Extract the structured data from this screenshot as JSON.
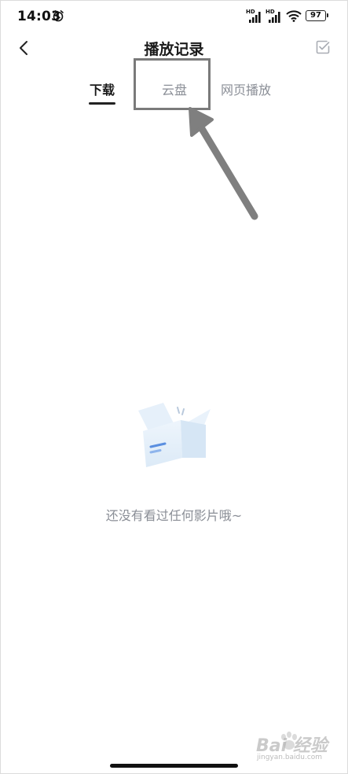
{
  "status_bar": {
    "time": "14:03",
    "signal1_label": "HD",
    "signal2_label": "HD",
    "battery": "97",
    "icons": [
      "alarm-icon",
      "signal-icon",
      "signal-icon",
      "wifi-icon",
      "battery-icon"
    ]
  },
  "header": {
    "title": "播放记录",
    "back_icon": "chevron-left-icon",
    "edit_icon": "checkbox-edit-icon"
  },
  "tabs": [
    {
      "label": "下载",
      "active": true
    },
    {
      "label": "云盘",
      "active": false
    },
    {
      "label": "网页播放",
      "active": false
    }
  ],
  "empty_state": {
    "message": "还没有看过任何影片哦~",
    "icon": "empty-box-icon"
  },
  "watermark": {
    "text": "Bai 经验",
    "url": "jingyan.baidu.com"
  },
  "colors": {
    "accent": "#222222",
    "muted_text": "#8a8e96",
    "annotation": "#7a7a7a"
  }
}
